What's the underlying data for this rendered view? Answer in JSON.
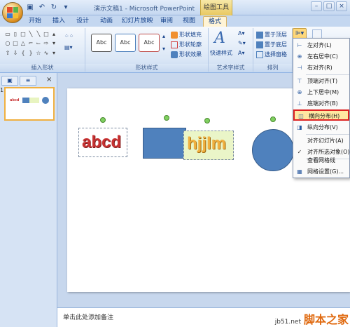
{
  "window": {
    "title": "演示文稿1 - Microsoft PowerPoint",
    "context_tab": "绘图工具"
  },
  "tabs": [
    {
      "label": "开始"
    },
    {
      "label": "插入"
    },
    {
      "label": "设计"
    },
    {
      "label": "动画"
    },
    {
      "label": "幻灯片放映"
    },
    {
      "label": "审阅"
    },
    {
      "label": "视图"
    },
    {
      "label": "格式"
    }
  ],
  "ribbon": {
    "groups": {
      "insert_shapes": "插入形状",
      "shape_styles": "形状样式",
      "art_styles": "艺术字样式",
      "arrange": "排列"
    },
    "style_boxes": [
      "Abc",
      "Abc",
      "Abc"
    ],
    "shape_fill": "形状填充",
    "shape_outline": "形状轮廓",
    "shape_effects": "形状效果",
    "quick_styles": "快速样式",
    "bring_front": "置于顶层",
    "send_back": "置于底层",
    "selection_pane": "选择窗格"
  },
  "menu": {
    "items": [
      {
        "label": "左对齐(L)",
        "icon": "⊢"
      },
      {
        "label": "左右居中(C)",
        "icon": "⊕"
      },
      {
        "label": "右对齐(R)",
        "icon": "⊣"
      },
      {
        "label": "顶端对齐(T)",
        "icon": "⊤"
      },
      {
        "label": "上下居中(M)",
        "icon": "⊕"
      },
      {
        "label": "底端对齐(B)",
        "icon": "⊥"
      },
      {
        "label": "横向分布(H)",
        "icon": "◫"
      },
      {
        "label": "纵向分布(V)",
        "icon": "◨"
      },
      {
        "label": "对齐幻灯片(A)",
        "icon": ""
      },
      {
        "label": "对齐所选对象(O)",
        "icon": "✓"
      },
      {
        "label": "查看网格线",
        "icon": ""
      },
      {
        "label": "网格设置(G)...",
        "icon": "▦"
      }
    ],
    "highlighted": "横向分布(H)"
  },
  "slide": {
    "text1": "abcd",
    "text2": "hjjlm"
  },
  "notes_placeholder": "单击此处添加备注",
  "watermark": {
    "site": "jb51.net",
    "name": "脚本之家"
  },
  "colors": {
    "accent_red": "#c83232",
    "shape_blue": "#4f81bd",
    "highlight_border": "#dd2222"
  }
}
